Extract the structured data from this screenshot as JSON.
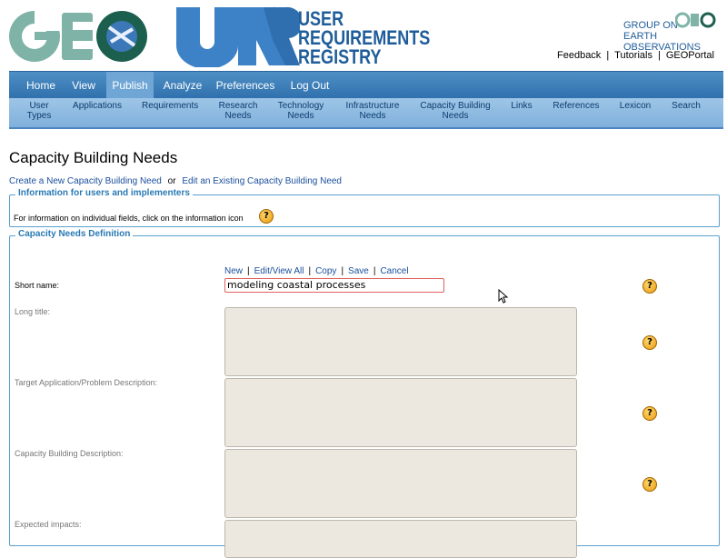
{
  "header": {
    "logo_geo": "GEO",
    "logo_urr": "URR",
    "urr_lines": [
      "USER",
      "REQUIREMENTS",
      "REGISTRY"
    ],
    "group_on_lines": [
      "GROUP ON",
      "EARTH OBSERVATIONS"
    ],
    "links": [
      "Feedback",
      "Tutorials",
      "GEOPortal"
    ]
  },
  "nav": {
    "primary": [
      "Home",
      "View",
      "Publish",
      "Analyze",
      "Preferences",
      "Log Out"
    ],
    "active": "Publish",
    "secondary": [
      [
        "User",
        "Types"
      ],
      [
        "Applications"
      ],
      [
        "Requirements"
      ],
      [
        "Research",
        "Needs"
      ],
      [
        "Technology",
        "Needs"
      ],
      [
        "Infrastructure",
        "Needs"
      ],
      [
        "Capacity Building",
        "Needs"
      ],
      [
        "Links"
      ],
      [
        "References"
      ],
      [
        "Lexicon"
      ],
      [
        "Search"
      ]
    ]
  },
  "page": {
    "title": "Capacity Building Needs",
    "create_link": "Create a New Capacity Building Need",
    "or_text": "or",
    "edit_link": "Edit an Existing Capacity Building Need"
  },
  "info_section": {
    "legend": "Information for users and implementers",
    "text": "For information on individual fields, click on the information icon"
  },
  "definition_section": {
    "legend": "Capacity Needs Definition",
    "form_links": [
      "New",
      "Edit/View All",
      "Copy",
      "Save",
      "Cancel"
    ],
    "fields": {
      "short_name": {
        "label": "Short name:",
        "value": "modeling coastal processes"
      },
      "long_title": {
        "label": "Long title:"
      },
      "target_application": {
        "label": "Target Application/Problem Description:"
      },
      "capacity_building": {
        "label": "Capacity Building Description:"
      },
      "expected_impacts": {
        "label": "Expected impacts:"
      }
    }
  },
  "help_icon_glyph": "?",
  "colors": {
    "nav_primary": "#3a7cb8",
    "nav_secondary": "#8fbbe1",
    "legend": "#2a7ab4",
    "link": "#1a4f9c",
    "brand": "#1f5d9a"
  }
}
